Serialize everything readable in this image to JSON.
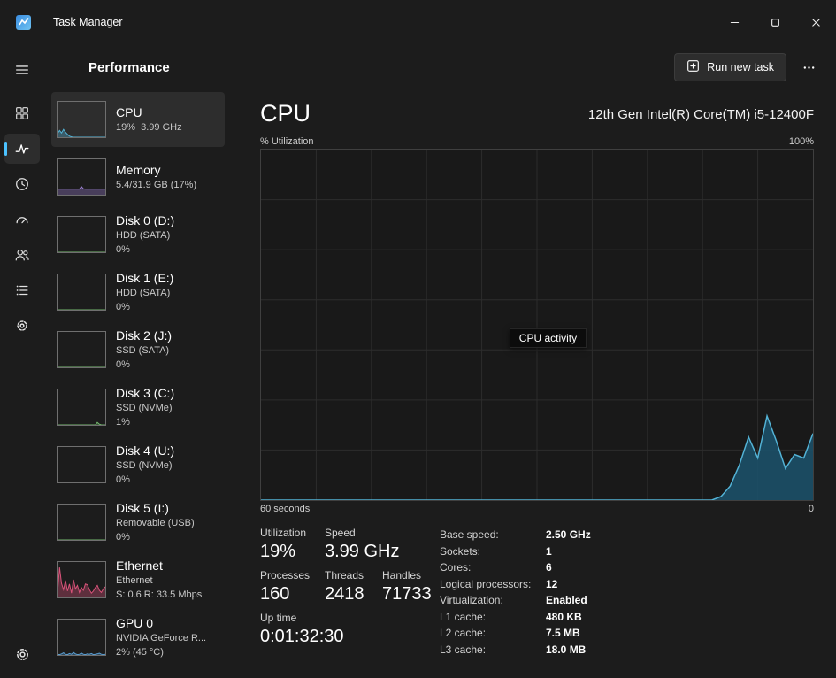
{
  "colors": {
    "accent": "#4cc2ff",
    "chart_grid": "#2d2d2d",
    "chart_border": "#3f3f3f"
  },
  "window": {
    "title": "Task Manager",
    "controls": [
      {
        "id": "minimize",
        "icon": "minimize-icon"
      },
      {
        "id": "maximize",
        "icon": "maximize-icon"
      },
      {
        "id": "close",
        "icon": "close-icon"
      }
    ]
  },
  "header": {
    "title": "Performance",
    "run_new_task_label": "Run new task",
    "run_new_task_icon": "new-task-icon",
    "more_icon": "more-icon"
  },
  "rail": {
    "menu_icon": "menu-icon",
    "settings_icon": "settings-icon",
    "items": [
      {
        "id": "processes",
        "icon": "processes-icon",
        "selected": false
      },
      {
        "id": "performance",
        "icon": "performance-icon",
        "selected": true
      },
      {
        "id": "app-history",
        "icon": "app-history-icon",
        "selected": false
      },
      {
        "id": "startup-apps",
        "icon": "startup-apps-icon",
        "selected": false
      },
      {
        "id": "users",
        "icon": "users-icon",
        "selected": false
      },
      {
        "id": "details",
        "icon": "details-icon",
        "selected": false
      },
      {
        "id": "services",
        "icon": "services-icon",
        "selected": false
      }
    ]
  },
  "sidebar": {
    "items": [
      {
        "id": "cpu",
        "title": "CPU",
        "lines": [
          "19%  3.99 GHz"
        ],
        "selected": true,
        "color": "#53b3d6",
        "spark": [
          10,
          19,
          12,
          22,
          14,
          8,
          3,
          1,
          0,
          0,
          0,
          0,
          0,
          0,
          0,
          0,
          0,
          0,
          0,
          0,
          0,
          0,
          0,
          0,
          0
        ]
      },
      {
        "id": "memory",
        "title": "Memory",
        "lines": [
          "5.4/31.9 GB (17%)"
        ],
        "selected": false,
        "color": "#9a7fd1",
        "spark": [
          16,
          16,
          16,
          16,
          16,
          16,
          16,
          16,
          16,
          16,
          16,
          16,
          23,
          17,
          16,
          16,
          16,
          16,
          16,
          16,
          16,
          16,
          16,
          16,
          16
        ]
      },
      {
        "id": "disk-0",
        "title": "Disk 0 (D:)",
        "lines": [
          "HDD (SATA)",
          "0%"
        ],
        "selected": false,
        "color": "#74b86e",
        "spark": [
          0,
          0,
          0,
          0,
          0,
          0,
          0,
          0,
          0,
          0,
          0,
          0,
          0,
          0,
          0,
          0,
          0,
          0,
          0,
          0,
          0,
          0,
          0,
          0,
          0
        ]
      },
      {
        "id": "disk-1",
        "title": "Disk 1 (E:)",
        "lines": [
          "HDD (SATA)",
          "0%"
        ],
        "selected": false,
        "color": "#74b86e",
        "spark": [
          0,
          0,
          0,
          0,
          0,
          0,
          0,
          0,
          0,
          0,
          0,
          0,
          0,
          0,
          0,
          0,
          0,
          0,
          0,
          0,
          0,
          0,
          0,
          0,
          0
        ]
      },
      {
        "id": "disk-2",
        "title": "Disk 2 (J:)",
        "lines": [
          "SSD (SATA)",
          "0%"
        ],
        "selected": false,
        "color": "#74b86e",
        "spark": [
          0,
          0,
          0,
          0,
          0,
          0,
          0,
          0,
          0,
          0,
          0,
          0,
          0,
          0,
          0,
          0,
          0,
          0,
          0,
          0,
          0,
          0,
          0,
          0,
          0
        ]
      },
      {
        "id": "disk-3",
        "title": "Disk 3 (C:)",
        "lines": [
          "SSD (NVMe)",
          "1%"
        ],
        "selected": false,
        "color": "#74b86e",
        "spark": [
          0,
          0,
          0,
          0,
          0,
          0,
          0,
          0,
          0,
          0,
          0,
          0,
          0,
          0,
          0,
          0,
          0,
          0,
          0,
          0,
          7,
          2,
          0,
          0,
          0
        ]
      },
      {
        "id": "disk-4",
        "title": "Disk 4 (U:)",
        "lines": [
          "SSD (NVMe)",
          "0%"
        ],
        "selected": false,
        "color": "#74b86e",
        "spark": [
          0,
          0,
          0,
          0,
          0,
          0,
          0,
          0,
          0,
          0,
          0,
          0,
          0,
          0,
          0,
          0,
          0,
          0,
          0,
          0,
          0,
          0,
          0,
          0,
          0
        ]
      },
      {
        "id": "disk-5",
        "title": "Disk 5 (I:)",
        "lines": [
          "Removable (USB)",
          "0%"
        ],
        "selected": false,
        "color": "#74b86e",
        "spark": [
          0,
          0,
          0,
          0,
          0,
          0,
          0,
          0,
          0,
          0,
          0,
          0,
          0,
          0,
          0,
          0,
          0,
          0,
          0,
          0,
          0,
          0,
          0,
          0,
          0
        ]
      },
      {
        "id": "ethernet",
        "title": "Ethernet",
        "lines": [
          "Ethernet",
          "S: 0.6 R: 33.5 Mbps"
        ],
        "selected": false,
        "color": "#d9537a",
        "spark": [
          12,
          85,
          40,
          22,
          48,
          18,
          38,
          12,
          50,
          24,
          34,
          14,
          28,
          20,
          38,
          36,
          22,
          12,
          18,
          28,
          34,
          20,
          14,
          24,
          30
        ]
      },
      {
        "id": "gpu-0",
        "title": "GPU 0",
        "lines": [
          "NVIDIA GeForce R...",
          "2% (45 °C)"
        ],
        "selected": false,
        "color": "#5a9fd4",
        "spark": [
          2,
          1,
          3,
          6,
          2,
          1,
          4,
          2,
          7,
          3,
          1,
          2,
          5,
          2,
          1,
          3,
          2,
          4,
          1,
          2,
          3,
          5,
          2,
          1,
          2
        ]
      }
    ]
  },
  "main": {
    "title": "CPU",
    "processor_name": "12th Gen Intel(R) Core(TM) i5-12400F",
    "tooltip": "CPU activity",
    "stats": {
      "utilization": {
        "label": "Utilization",
        "value": "19%"
      },
      "speed": {
        "label": "Speed",
        "value": "3.99 GHz"
      },
      "processes": {
        "label": "Processes",
        "value": "160"
      },
      "threads": {
        "label": "Threads",
        "value": "2418"
      },
      "handles": {
        "label": "Handles",
        "value": "71733"
      },
      "uptime": {
        "label": "Up time",
        "value": "0:01:32:30"
      }
    },
    "details": [
      {
        "label": "Base speed:",
        "value": "2.50 GHz"
      },
      {
        "label": "Sockets:",
        "value": "1"
      },
      {
        "label": "Cores:",
        "value": "6"
      },
      {
        "label": "Logical processors:",
        "value": "12"
      },
      {
        "label": "Virtualization:",
        "value": "Enabled"
      },
      {
        "label": "L1 cache:",
        "value": "480 KB"
      },
      {
        "label": "L2 cache:",
        "value": "7.5 MB"
      },
      {
        "label": "L3 cache:",
        "value": "18.0 MB"
      }
    ]
  },
  "chart_data": {
    "type": "area",
    "title": "% Utilization",
    "y_top_label": "100%",
    "x_range_label_left": "60 seconds",
    "x_range_label_right": "0",
    "ylim": [
      0,
      100
    ],
    "x_seconds_span": 60,
    "grid": true,
    "legend_position": "none",
    "line_color": "#53b3d6",
    "fill_color": "#1c5068",
    "series": [
      {
        "name": "CPU utilization (%)",
        "values": [
          0,
          0,
          0,
          0,
          0,
          0,
          0,
          0,
          0,
          0,
          0,
          0,
          0,
          0,
          0,
          0,
          0,
          0,
          0,
          0,
          0,
          0,
          0,
          0,
          0,
          0,
          0,
          0,
          0,
          0,
          0,
          0,
          0,
          0,
          0,
          0,
          0,
          0,
          0,
          0,
          0,
          0,
          0,
          0,
          0,
          0,
          0,
          0,
          0,
          0,
          1,
          4,
          10,
          18,
          12,
          24,
          17,
          9,
          13,
          12,
          19
        ]
      }
    ]
  }
}
